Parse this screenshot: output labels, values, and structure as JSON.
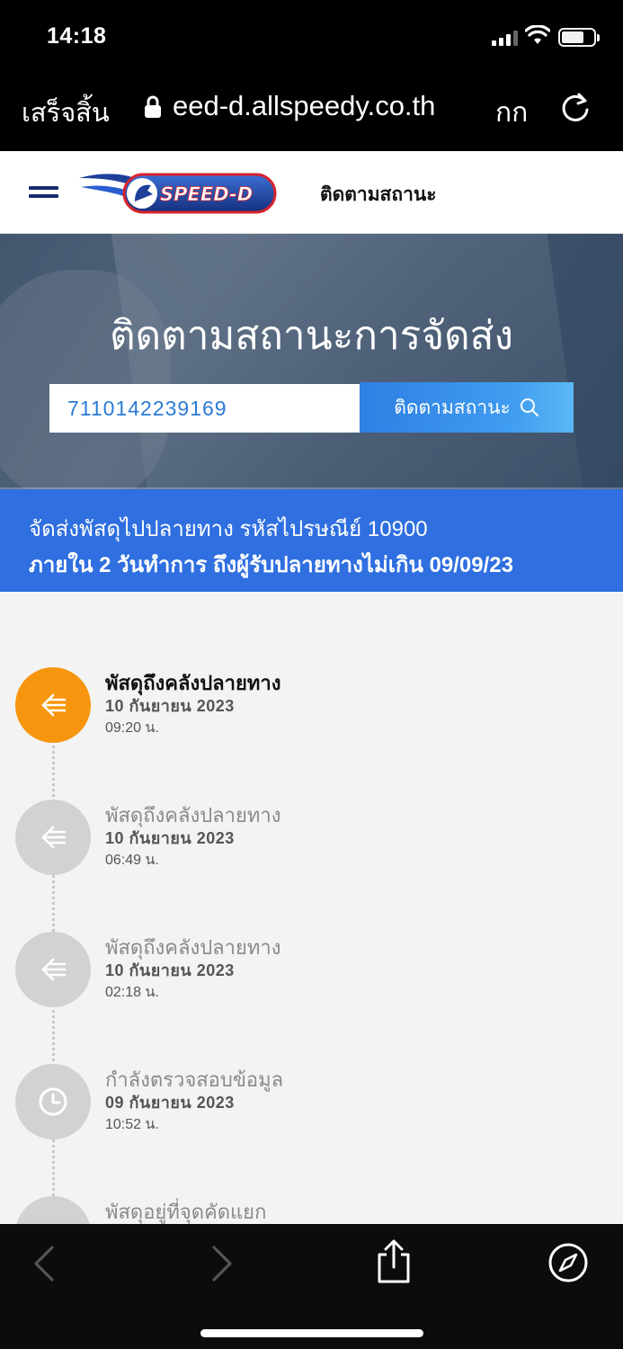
{
  "status_bar": {
    "time": "14:18"
  },
  "browser": {
    "done_label": "เสร็จสิ้น",
    "url": "eed-d.allspeedy.co.th",
    "text_size_label": "กก"
  },
  "header": {
    "logo_text": "SPEED-D",
    "nav_link": "ติดตามสถานะ"
  },
  "hero": {
    "title": "ติดตามสถานะการจัดส่ง",
    "tracking_number": "7110142239169",
    "track_button": "ติดตามสถานะ"
  },
  "banner": {
    "line1": "จัดส่งพัสดุไปปลายทาง รหัสไปรษณีย์ 10900",
    "line2": "ภายใน 2 วันทำการ ถึงผู้รับปลายทางไม่เกิน 09/09/23",
    "color": "#2f6fe0"
  },
  "timeline": [
    {
      "title": "พัสดุถึงคลังปลายทาง",
      "date": "10 กันยายน 2023",
      "time": "09:20 น.",
      "icon": "arrow-left-icon",
      "active": true
    },
    {
      "title": "พัสดุถึงคลังปลายทาง",
      "date": "10 กันยายน 2023",
      "time": "06:49 น.",
      "icon": "arrow-left-icon",
      "active": false
    },
    {
      "title": "พัสดุถึงคลังปลายทาง",
      "date": "10 กันยายน 2023",
      "time": "02:18 น.",
      "icon": "arrow-left-icon",
      "active": false
    },
    {
      "title": "กำลังตรวจสอบข้อมูล",
      "date": "09 กันยายน 2023",
      "time": "10:52 น.",
      "icon": "clock-icon",
      "active": false
    },
    {
      "title": "พัสดุอยู่ที่จุดคัดแยก",
      "date": "",
      "time": "",
      "icon": "package-icon",
      "active": false
    }
  ],
  "colors": {
    "active": "#f7960e",
    "inactive": "#d2d2d2",
    "accent": "#2f7fe3"
  }
}
